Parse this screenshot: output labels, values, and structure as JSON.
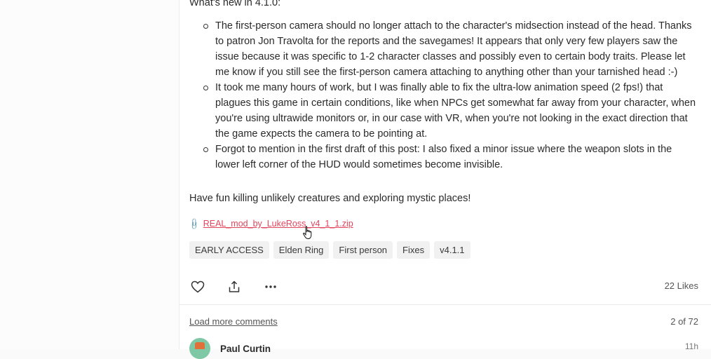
{
  "post": {
    "heading": "What's new in 4.1.0:",
    "changes": [
      "The first-person camera should no longer attach to the character's midsection instead of the head. Thanks to patron Jon Travolta for the reports and the savegames! It appears that only very few players saw the issue because it was specific to 1-2 character classes and possibly even to certain body traits. Please let me know if you still see the first-person camera attaching to anything other than your tarnished head :-)",
      "It took me many hours of work, but I was finally able to fix the ultra-low animation speed (2 fps!) that plagues this game in certain conditions, like when NPCs get somewhat far away from your character, when you're using ultrawide monitors or, in our case with VR, when you're not looking in the exact direction that the game expects the camera to be pointing at.",
      "Forgot to mention in the first draft of this post: I also fixed a minor issue where the weapon slots in the lower left corner of the HUD would sometimes become invisible."
    ],
    "closing": "Have fun killing unlikely creatures and exploring mystic places!",
    "attachment": {
      "filename": "REAL_mod_by_LukeRoss_v4_1_1.zip",
      "icon": "paperclip-icon"
    },
    "tags": [
      "EARLY ACCESS",
      "Elden Ring",
      "First person",
      "Fixes",
      "v4.1.1"
    ],
    "actions": {
      "like_icon": "heart-icon",
      "share_icon": "share-icon",
      "more_icon": "more-icon",
      "likes": "22 Likes"
    }
  },
  "comments": {
    "load_more": "Load more comments",
    "count": "2 of 72",
    "first": {
      "name": "Paul Curtin",
      "time": "11h"
    }
  },
  "colors": {
    "link": "#e0455d",
    "tag_bg": "#f1f1f1"
  }
}
